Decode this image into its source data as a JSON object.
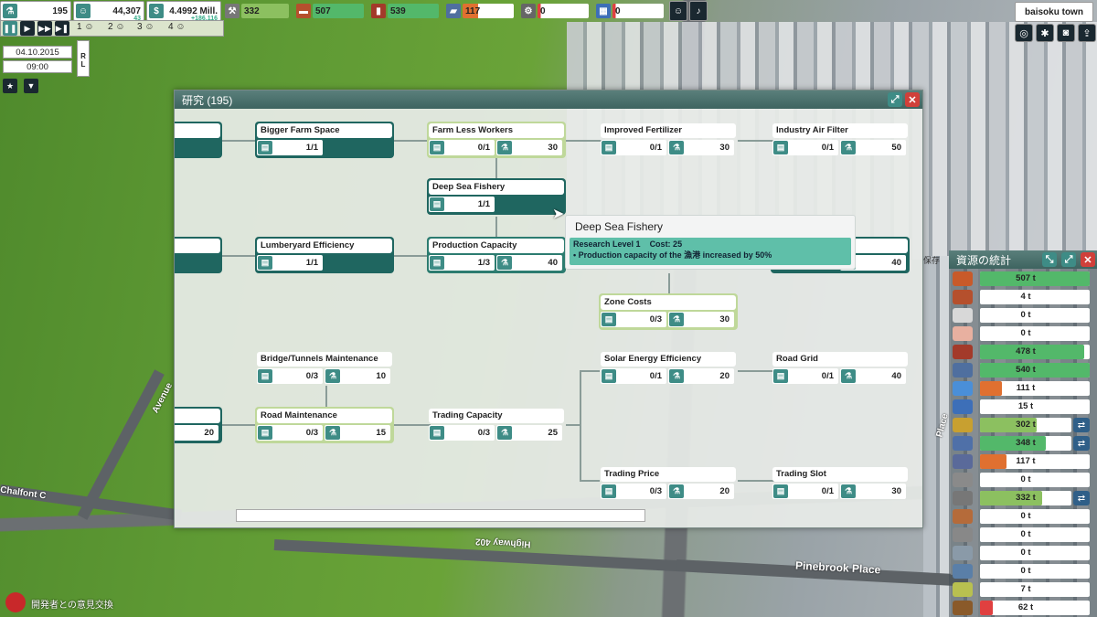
{
  "hud": {
    "stat1": "195",
    "stat2": "44,307",
    "stat2_sub": "43",
    "money": "4.4992 Mill.",
    "money_delta": "+186,116",
    "res1": "332",
    "res2": "507",
    "res3": "539",
    "res4": "117",
    "res5": "0",
    "res6": "0",
    "town": "baisoku town"
  },
  "speed": {
    "slot1": "1",
    "slot2": "2",
    "slot3": "3",
    "slot4": "4",
    "date": "04.10.2015",
    "time": "09:00",
    "rl": "R\nL"
  },
  "research": {
    "title": "研究 (195)",
    "nodes": [
      {
        "id": "farm-space",
        "name": "Bigger Farm Space",
        "level": "1/1",
        "cost": ""
      },
      {
        "id": "farm-workers",
        "name": "Farm Less Workers",
        "level": "0/1",
        "cost": "30"
      },
      {
        "id": "fertilizer",
        "name": "Improved Fertilizer",
        "level": "0/1",
        "cost": "30"
      },
      {
        "id": "air-filter",
        "name": "Industry Air Filter",
        "level": "0/1",
        "cost": "50"
      },
      {
        "id": "deep-sea",
        "name": "Deep Sea Fishery",
        "level": "1/1",
        "cost": ""
      },
      {
        "id": "lumber",
        "name": "Lumberyard Efficiency",
        "level": "1/1",
        "cost": ""
      },
      {
        "id": "production",
        "name": "Production Capacity",
        "level": "1/3",
        "cost": "40"
      },
      {
        "id": "hidden-right",
        "name": "",
        "level": "",
        "cost": "40"
      },
      {
        "id": "zone-costs",
        "name": "Zone Costs",
        "level": "0/3",
        "cost": "30"
      },
      {
        "id": "bridge",
        "name": "Bridge/Tunnels Maintenance",
        "level": "0/3",
        "cost": "10"
      },
      {
        "id": "solar",
        "name": "Solar Energy Efficiency",
        "level": "0/1",
        "cost": "20"
      },
      {
        "id": "road-grid",
        "name": "Road Grid",
        "level": "0/1",
        "cost": "40"
      },
      {
        "id": "left-cut",
        "name": "",
        "level": "",
        "cost": "20"
      },
      {
        "id": "road-maint",
        "name": "Road Maintenance",
        "level": "0/3",
        "cost": "15"
      },
      {
        "id": "trading-cap",
        "name": "Trading Capacity",
        "level": "0/3",
        "cost": "25"
      },
      {
        "id": "trading-price",
        "name": "Trading Price",
        "level": "0/3",
        "cost": "20"
      },
      {
        "id": "trading-slot",
        "name": "Trading Slot",
        "level": "0/1",
        "cost": "30"
      }
    ]
  },
  "tooltip": {
    "title": "Deep Sea Fishery",
    "level": "Research Level 1",
    "cost": "Cost: 25",
    "effect": "• Production capacity of the 漁港 increased by 50%"
  },
  "stats": {
    "title": "資源の統計",
    "rows": [
      {
        "value": "507 t",
        "fill": 1.0,
        "color": "#53b86a",
        "icon": "first-row-icon",
        "swap": false
      },
      {
        "value": "4 t",
        "fill": 0,
        "color": "#53b86a",
        "icon": "wood-icon",
        "swap": false
      },
      {
        "value": "0 t",
        "fill": 0,
        "color": "#53b86a",
        "icon": "plank-icon",
        "swap": false
      },
      {
        "value": "0 t",
        "fill": 0,
        "color": "#53b86a",
        "icon": "brick-icon",
        "swap": false
      },
      {
        "value": "478 t",
        "fill": 0.95,
        "color": "#53b86a",
        "icon": "ore-icon",
        "swap": false
      },
      {
        "value": "540 t",
        "fill": 1.0,
        "color": "#53b86a",
        "icon": "metal-icon",
        "swap": false
      },
      {
        "value": "111 t",
        "fill": 0.2,
        "color": "#e07030",
        "icon": "pipe-icon",
        "swap": false
      },
      {
        "value": "15 t",
        "fill": 0,
        "color": "#53b86a",
        "icon": "clothes-icon",
        "swap": false
      },
      {
        "value": "302 t",
        "fill": 0.62,
        "color": "#8cc060",
        "icon": "grain-icon",
        "swap": true
      },
      {
        "value": "348 t",
        "fill": 0.72,
        "color": "#53b86a",
        "icon": "fish-icon",
        "swap": true
      },
      {
        "value": "117 t",
        "fill": 0.24,
        "color": "#e07030",
        "icon": "stone-icon",
        "swap": false
      },
      {
        "value": "0 t",
        "fill": 0,
        "color": "#53b86a",
        "icon": "machine-icon",
        "swap": false
      },
      {
        "value": "332 t",
        "fill": 0.68,
        "color": "#8cc060",
        "icon": "tools-icon",
        "swap": true
      },
      {
        "value": "0 t",
        "fill": 0,
        "color": "#53b86a",
        "icon": "furniture-icon",
        "swap": false
      },
      {
        "value": "0 t",
        "fill": 0,
        "color": "#53b86a",
        "icon": "car-icon",
        "swap": false
      },
      {
        "value": "0 t",
        "fill": 0,
        "color": "#53b86a",
        "icon": "electronics-icon",
        "swap": false
      },
      {
        "value": "0 t",
        "fill": 0,
        "color": "#53b86a",
        "icon": "chemical-icon",
        "swap": false
      },
      {
        "value": "7 t",
        "fill": 0,
        "color": "#53b86a",
        "icon": "fruit-icon",
        "swap": false
      },
      {
        "value": "62 t",
        "fill": 0.12,
        "color": "#e04040",
        "icon": "food-icon",
        "swap": false
      }
    ]
  },
  "map": {
    "road1": "Highway 402",
    "road2": "Pinebrook Place",
    "road3": "Chalfont C",
    "road4": "Avenue",
    "road5": "Place",
    "save": "保存",
    "feedback": "開発者との意見交換"
  }
}
